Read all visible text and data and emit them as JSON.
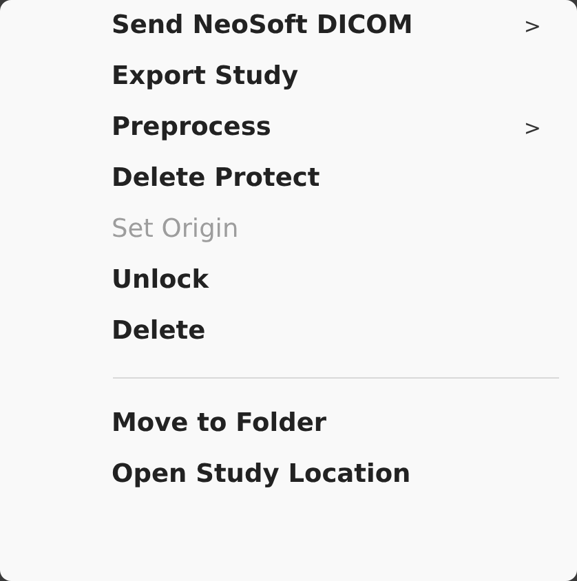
{
  "menu": {
    "items": [
      {
        "kind": "item",
        "label": "Send NeoSoft DICOM",
        "disabled": false,
        "chevron": ">"
      },
      {
        "kind": "item",
        "label": "Export Study",
        "disabled": false
      },
      {
        "kind": "item",
        "label": "Preprocess",
        "disabled": false,
        "chevron": ">"
      },
      {
        "kind": "item",
        "label": "Delete Protect",
        "disabled": false
      },
      {
        "kind": "item",
        "label": "Set Origin",
        "disabled": true
      },
      {
        "kind": "item",
        "label": "Unlock",
        "disabled": false
      },
      {
        "kind": "item",
        "label": "Delete",
        "disabled": false
      },
      {
        "kind": "separator"
      },
      {
        "kind": "item",
        "label": "Move to Folder",
        "disabled": false
      },
      {
        "kind": "item",
        "label": "Open Study Location",
        "disabled": false
      }
    ]
  }
}
